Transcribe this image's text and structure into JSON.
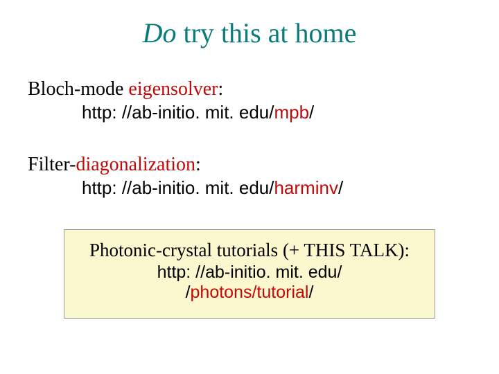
{
  "title": {
    "em": "Do",
    "rest": " try this at home"
  },
  "sections": [
    {
      "label_prefix": "Bloch-mode ",
      "label_highlight": "eigensolver",
      "label_suffix": ":",
      "url_prefix": "http: //ab-initio. mit. edu/",
      "url_highlight": "mpb",
      "url_suffix": "/"
    },
    {
      "label_prefix": "Filter-",
      "label_highlight": "diagonalization",
      "label_suffix": ":",
      "url_prefix": "http: //ab-initio. mit. edu/",
      "url_highlight": "harminv",
      "url_suffix": "/"
    }
  ],
  "callout": {
    "label_prefix": "Photonic-crystal tutorials",
    "label_suffix": " (+ THIS TALK):",
    "url_line1": "http: //ab-initio. mit. edu/",
    "url_line2_prefix": "/",
    "url_line2_highlight": "photons/tutorial",
    "url_line2_suffix": "/"
  }
}
